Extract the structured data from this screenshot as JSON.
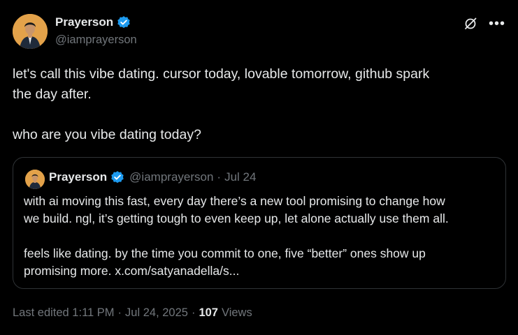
{
  "author": {
    "display_name": "Prayerson",
    "handle": "@iamprayerson",
    "avatar_icon": "person-avatar",
    "verified_icon": "verified-badge-icon",
    "verified_color": "#1d9bf0"
  },
  "actions": {
    "grok_icon": "grok-icon",
    "more_icon": "more-options-icon"
  },
  "tweet": {
    "line1": "let's call this vibe dating. cursor today, lovable tomorrow, github spark",
    "line2": "the day after.",
    "line3": "who are you vibe dating today?"
  },
  "quote": {
    "display_name": "Prayerson",
    "handle": "@iamprayerson",
    "separator": "·",
    "date": "Jul 24",
    "line1": "with ai moving this fast, every day there’s a new tool promising to change how",
    "line2": "we build. ngl, it’s getting tough to even keep up, let alone actually use them all.",
    "line3": "feels like dating. by the time you commit to one, five “better” ones show up",
    "line4": "promising more. x.com/satyanadella/s..."
  },
  "meta": {
    "edited_label": "Last edited 1:11 PM",
    "separator1": "·",
    "date": "Jul 24, 2025",
    "separator2": "·",
    "views_count": "107",
    "views_label": "Views"
  },
  "colors": {
    "background": "#000000",
    "text_primary": "#e7e9ea",
    "text_secondary": "#71767b",
    "border": "#2f3336",
    "avatar_bg": "#e3a24a"
  }
}
